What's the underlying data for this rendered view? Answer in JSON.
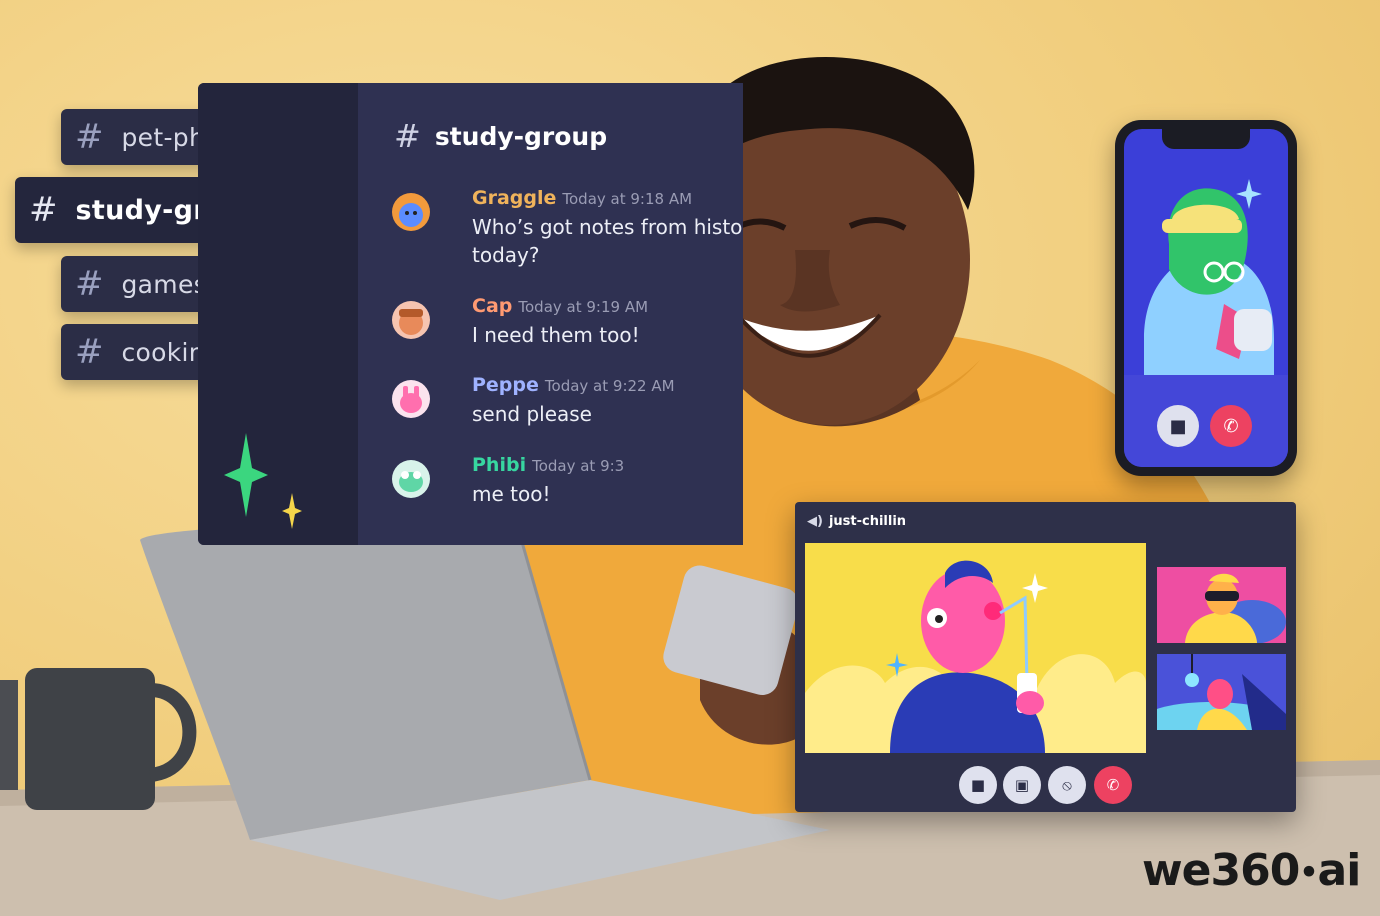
{
  "channels": [
    {
      "label": "pet-photos",
      "active": false
    },
    {
      "label": "study-group",
      "active": true
    },
    {
      "label": "games",
      "active": false
    },
    {
      "label": "cooking",
      "active": false
    }
  ],
  "chat": {
    "channel_title": "study-group",
    "messages": [
      {
        "name": "Graggle",
        "name_color": "#f0b35b",
        "time": "Today at 9:18 AM",
        "text": "Who’s got notes from history today?"
      },
      {
        "name": "Cap",
        "name_color": "#ff9a72",
        "time": "Today at 9:19 AM",
        "text": "I need them too!"
      },
      {
        "name": "Peppe",
        "name_color": "#9fb2ff",
        "time": "Today at 9:22 AM",
        "text": "send please"
      },
      {
        "name": "Phibi",
        "name_color": "#37d6a0",
        "time": "Today at 9:3",
        "text": "me too!"
      }
    ]
  },
  "voice_call": {
    "channel_name": "just-chillin",
    "controls": [
      "video-icon",
      "screen-share-icon",
      "mute-icon",
      "hang-up-icon"
    ]
  },
  "phone_call": {
    "controls": [
      "video-icon",
      "hang-up-icon"
    ]
  },
  "brand": {
    "logo_text": "we360",
    "logo_suffix": "ai"
  },
  "colors": {
    "background": "#f1ce7e",
    "sidebar": "#23253c",
    "chat": "#2f3152",
    "hang_up": "#ed4261",
    "sparkle_green": "#3bd67f",
    "sparkle_yellow": "#f5d54a"
  }
}
